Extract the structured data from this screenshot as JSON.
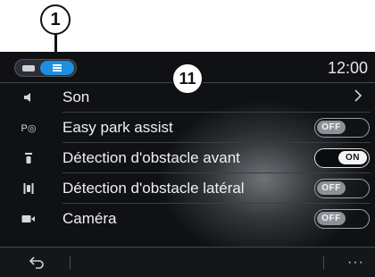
{
  "callouts": {
    "top": "1",
    "center": "11"
  },
  "status": {
    "time": "12:00"
  },
  "settings": [
    {
      "label": "Son",
      "icon": "speaker-icon",
      "control": "chevron"
    },
    {
      "label": "Easy park assist",
      "icon": "park-assist-icon",
      "control": "toggle",
      "state": "OFF"
    },
    {
      "label": "Détection d'obstacle avant",
      "icon": "front-obstacle-icon",
      "control": "toggle",
      "state": "ON"
    },
    {
      "label": "Détection d'obstacle latéral",
      "icon": "side-obstacle-icon",
      "control": "toggle",
      "state": "OFF"
    },
    {
      "label": "Caméra",
      "icon": "camera-icon",
      "control": "toggle",
      "state": "OFF"
    }
  ],
  "icons": {
    "park_assist_glyph": "P◎",
    "more": "···"
  },
  "colors": {
    "accent": "#1e8fe0",
    "background": "#0f1114",
    "text": "#f0f0f0"
  }
}
